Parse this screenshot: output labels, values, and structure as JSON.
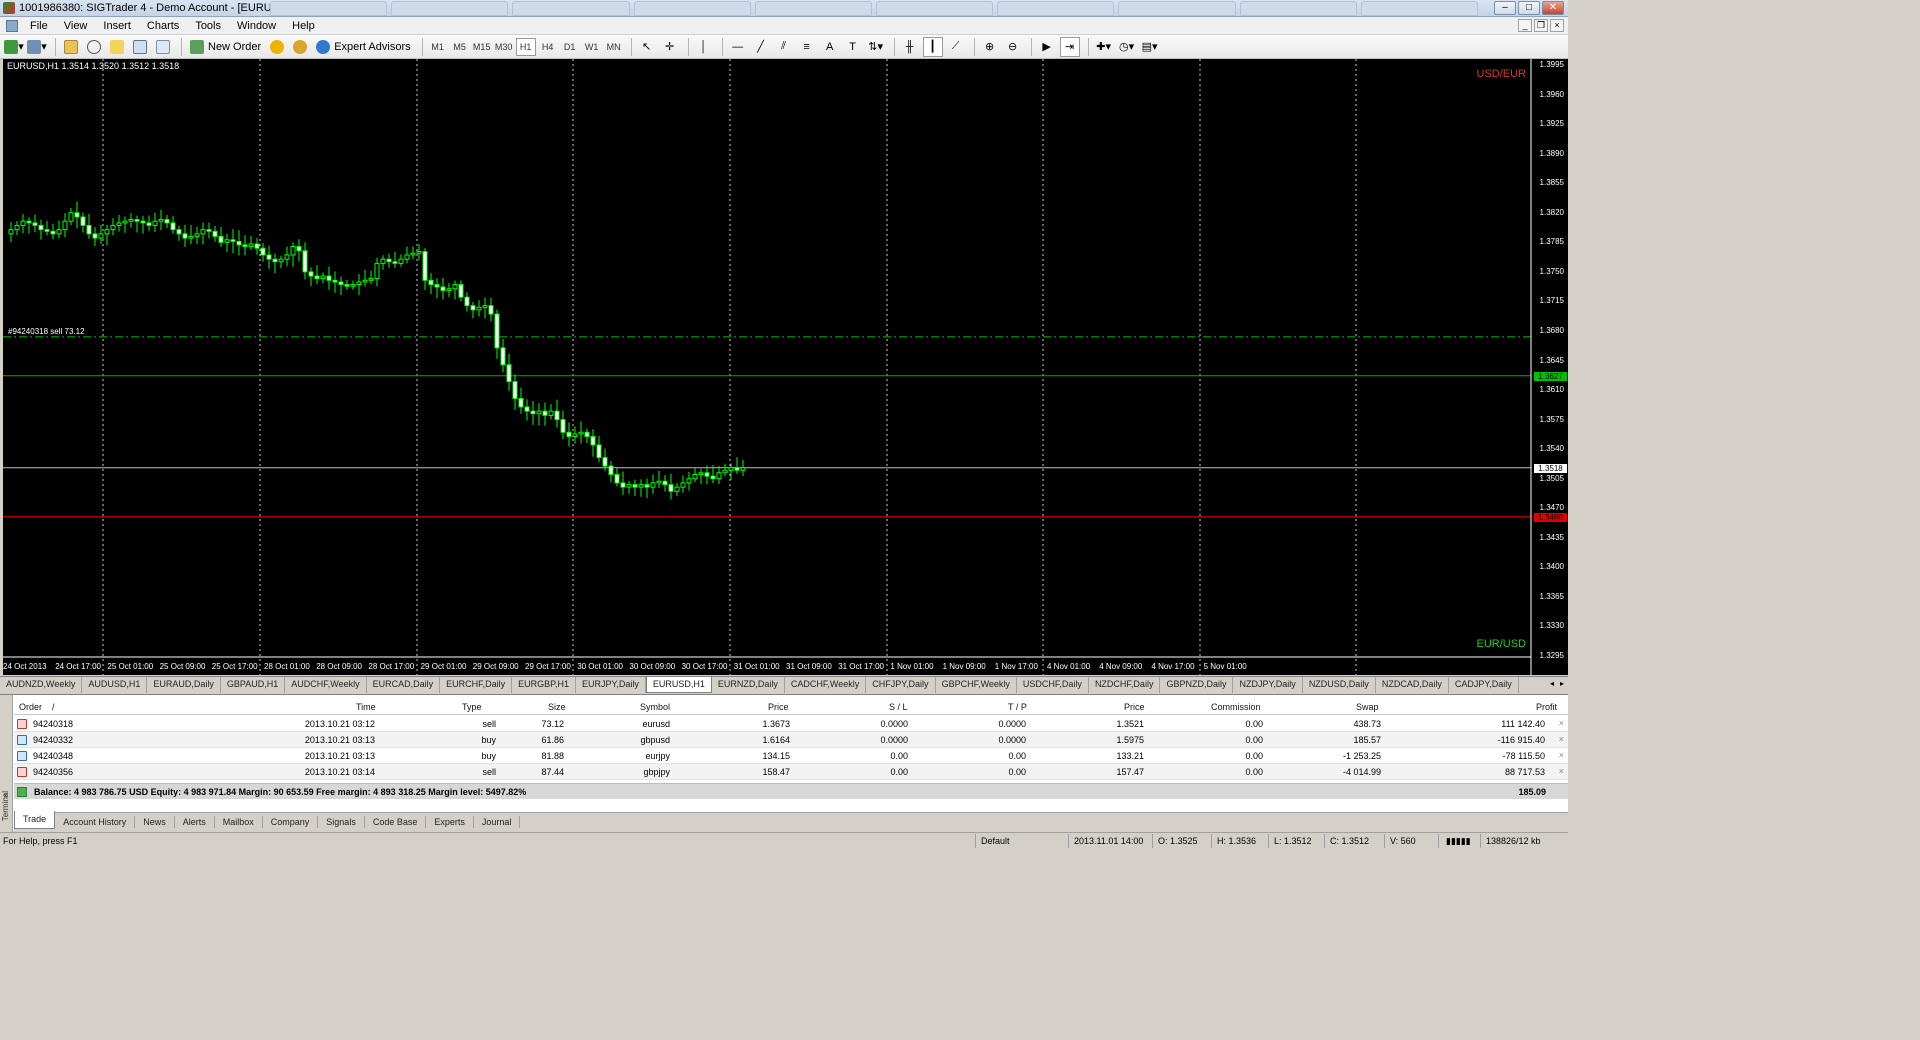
{
  "window": {
    "title": "1001986380: SIGTrader 4 - Demo Account - [EURUSD,H1]"
  },
  "menu": [
    "File",
    "View",
    "Insert",
    "Charts",
    "Tools",
    "Window",
    "Help"
  ],
  "toolbar": {
    "new_order": "New Order",
    "expert_advisors": "Expert Advisors",
    "timeframes": [
      "M1",
      "M5",
      "M15",
      "M30",
      "H1",
      "H4",
      "D1",
      "W1",
      "MN"
    ],
    "active_timeframe": "H1"
  },
  "chart": {
    "symbol_header": "EURUSD,H1  1.3514 1.3520 1.3512 1.3518",
    "label_top": "USD/EUR",
    "label_bottom": "EUR/USD",
    "order_label": "#94240318 sell 73.12",
    "colors": {
      "background": "#000000",
      "bull": "#00ff00",
      "bear": "#00ff00",
      "grid": "#ffffff",
      "buy_line": "#00c000",
      "stop_line": "#ff0000",
      "bid_line": "#c0c0c0"
    },
    "price_labels": [
      "1.3995",
      "1.3960",
      "1.3925",
      "1.3890",
      "1.3855",
      "1.3820",
      "1.3785",
      "1.3750",
      "1.3715",
      "1.3680",
      "1.3645",
      "1.3610",
      "1.3575",
      "1.3540",
      "1.3505",
      "1.3470",
      "1.3435",
      "1.3400",
      "1.3365",
      "1.3330",
      "1.3295"
    ],
    "price_tags": {
      "green": "1.3627",
      "white": "1.3518",
      "red": "1.3460"
    },
    "time_labels": [
      "24 Oct 2013",
      "24 Oct 17:00",
      "25 Oct 01:00",
      "25 Oct 09:00",
      "25 Oct 17:00",
      "28 Oct 01:00",
      "28 Oct 09:00",
      "28 Oct 17:00",
      "29 Oct 01:00",
      "29 Oct 09:00",
      "29 Oct 17:00",
      "30 Oct 01:00",
      "30 Oct 09:00",
      "30 Oct 17:00",
      "31 Oct 01:00",
      "31 Oct 09:00",
      "31 Oct 17:00",
      "1 Nov 01:00",
      "1 Nov 09:00",
      "1 Nov 17:00",
      "4 Nov 01:00",
      "4 Nov 09:00",
      "4 Nov 17:00",
      "5 Nov 01:00"
    ]
  },
  "chart_data": {
    "type": "candlestick",
    "symbol": "EURUSD",
    "timeframe": "H1",
    "ylim": [
      1.3295,
      1.3995
    ],
    "horizontal_lines": [
      {
        "name": "#94240318 sell 73.12",
        "value": 1.3673,
        "style": "dash-dot"
      },
      {
        "value": 1.3627,
        "style": "solid"
      },
      {
        "value": 1.3518,
        "style": "solid"
      },
      {
        "value": 1.346,
        "style": "solid"
      }
    ],
    "close_path": [
      1.38,
      1.3805,
      1.381,
      1.3808,
      1.3805,
      1.38,
      1.3798,
      1.3795,
      1.38,
      1.381,
      1.382,
      1.3815,
      1.3805,
      1.3795,
      1.379,
      1.3795,
      1.38,
      1.3805,
      1.3808,
      1.381,
      1.3812,
      1.381,
      1.3808,
      1.3805,
      1.381,
      1.3812,
      1.3808,
      1.38,
      1.3795,
      1.379,
      1.3792,
      1.3795,
      1.38,
      1.3798,
      1.3792,
      1.3785,
      1.3788,
      1.3786,
      1.3782,
      1.378,
      1.3783,
      1.3778,
      1.377,
      1.3765,
      1.3762,
      1.3765,
      1.377,
      1.378,
      1.3775,
      1.375,
      1.3745,
      1.3742,
      1.3745,
      1.374,
      1.3738,
      1.3735,
      1.3733,
      1.3735,
      1.3738,
      1.374,
      1.3742,
      1.376,
      1.3765,
      1.3762,
      1.376,
      1.3765,
      1.377,
      1.3772,
      1.3774,
      1.374,
      1.3735,
      1.3732,
      1.3728,
      1.373,
      1.3735,
      1.372,
      1.371,
      1.3705,
      1.3708,
      1.371,
      1.37,
      1.366,
      1.364,
      1.362,
      1.36,
      1.359,
      1.3585,
      1.3582,
      1.3585,
      1.358,
      1.3585,
      1.3575,
      1.356,
      1.3555,
      1.3558,
      1.356,
      1.3555,
      1.3545,
      1.353,
      1.352,
      1.351,
      1.35,
      1.3495,
      1.3498,
      1.3495,
      1.3498,
      1.3495,
      1.35,
      1.3502,
      1.3498,
      1.349,
      1.3495,
      1.35,
      1.3505,
      1.351,
      1.3512,
      1.3508,
      1.3505,
      1.3512,
      1.3515,
      1.3518,
      1.3515,
      1.3518
    ]
  },
  "chart_tabs": [
    "AUDNZD,Weekly",
    "AUDUSD,H1",
    "EURAUD,Daily",
    "GBPAUD,H1",
    "AUDCHF,Weekly",
    "EURCAD,Daily",
    "EURCHF,Daily",
    "EURGBP,H1",
    "EURJPY,Daily",
    "EURUSD,H1",
    "EURNZD,Daily",
    "CADCHF,Weekly",
    "CHFJPY,Daily",
    "GBPCHF,Weekly",
    "USDCHF,Daily",
    "NZDCHF,Daily",
    "GBPNZD,Daily",
    "NZDJPY,Daily",
    "NZDUSD,Daily",
    "NZDCAD,Daily",
    "CADJPY,Daily"
  ],
  "active_chart_tab": "EURUSD,H1",
  "terminal": {
    "side_label": "Terminal",
    "headers": [
      "Order",
      "/",
      "Time",
      "Type",
      "Size",
      "Symbol",
      "Price",
      "S / L",
      "T / P",
      "Price",
      "Commission",
      "Swap",
      "Profit"
    ],
    "rows": [
      {
        "order": "94240318",
        "time": "2013.10.21 03:12",
        "type": "sell",
        "size": "73.12",
        "symbol": "eurusd",
        "price": "1.3673",
        "sl": "0.0000",
        "tp": "0.0000",
        "cur": "1.3521",
        "commission": "0.00",
        "swap": "438.73",
        "profit": "111 142.40"
      },
      {
        "order": "94240332",
        "time": "2013.10.21 03:13",
        "type": "buy",
        "size": "61.86",
        "symbol": "gbpusd",
        "price": "1.6164",
        "sl": "0.0000",
        "tp": "0.0000",
        "cur": "1.5975",
        "commission": "0.00",
        "swap": "185.57",
        "profit": "-116 915.40"
      },
      {
        "order": "94240348",
        "time": "2013.10.21 03:13",
        "type": "buy",
        "size": "81.88",
        "symbol": "eurjpy",
        "price": "134.15",
        "sl": "0.00",
        "tp": "0.00",
        "cur": "133.21",
        "commission": "0.00",
        "swap": "-1 253.25",
        "profit": "-78 115.50"
      },
      {
        "order": "94240356",
        "time": "2013.10.21 03:14",
        "type": "sell",
        "size": "87.44",
        "symbol": "gbpjpy",
        "price": "158.47",
        "sl": "0.00",
        "tp": "0.00",
        "cur": "157.47",
        "commission": "0.00",
        "swap": "-4 014.99",
        "profit": "88 717.53"
      }
    ],
    "balance_line": "Balance: 4 983 786.75 USD  Equity: 4 983 971.84  Margin: 90 653.59  Free margin: 4 893 318.25  Margin level: 5497.82%",
    "total_profit": "185.09",
    "tabs": [
      "Trade",
      "Account History",
      "News",
      "Alerts",
      "Mailbox",
      "Company",
      "Signals",
      "Code Base",
      "Experts",
      "Journal"
    ],
    "active_tab": "Trade"
  },
  "status": {
    "help": "For Help, press F1",
    "profile": "Default",
    "datetime": "2013.11.01 14:00",
    "open": "O: 1.3525",
    "high": "H: 1.3536",
    "low": "L: 1.3512",
    "close": "C: 1.3512",
    "volume": "V: 560",
    "traffic": "138826/12 kb"
  }
}
